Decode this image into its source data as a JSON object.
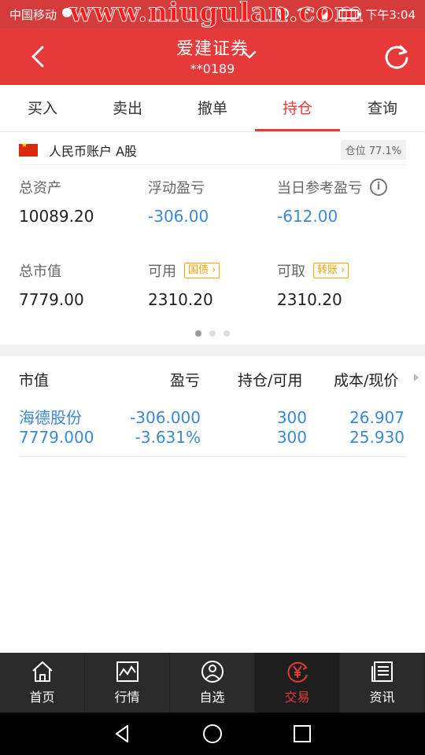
{
  "status_bar": {
    "carrier": "中国移动",
    "watermark": "www.niugulan.com",
    "time": "下午3:04"
  },
  "header": {
    "title": "爱建证券",
    "account_suffix": "**0189"
  },
  "tabs": [
    {
      "label": "买入"
    },
    {
      "label": "卖出"
    },
    {
      "label": "撤单"
    },
    {
      "label": "持仓",
      "active": true
    },
    {
      "label": "查询"
    }
  ],
  "account": {
    "label": "人民币账户 A股",
    "position_ratio": "仓位 77.1%"
  },
  "summary": {
    "total_assets_label": "总资产",
    "total_assets_value": "10089.20",
    "floating_pl_label": "浮动盈亏",
    "floating_pl_value": "-306.00",
    "daily_ref_pl_label": "当日参考盈亏",
    "daily_ref_pl_value": "-612.00",
    "market_value_label": "总市值",
    "market_value_value": "7779.00",
    "available_label": "可用",
    "available_tag": "国债",
    "available_value": "2310.20",
    "withdrawable_label": "可取",
    "withdrawable_tag": "转账",
    "withdrawable_value": "2310.20"
  },
  "pager": {
    "count": 3,
    "active": 0
  },
  "table": {
    "headers": [
      "市值",
      "盈亏",
      "持仓/可用",
      "成本/现价"
    ],
    "rows": [
      {
        "name": "海德股份",
        "market_value": "7779.000",
        "pl": "-306.000",
        "pl_pct": "-3.631%",
        "holding": "300",
        "available": "300",
        "cost": "26.907",
        "price": "25.930"
      }
    ]
  },
  "bottom_nav": [
    {
      "label": "首页",
      "icon": "home-icon"
    },
    {
      "label": "行情",
      "icon": "market-chart-icon"
    },
    {
      "label": "自选",
      "icon": "user-icon"
    },
    {
      "label": "交易",
      "icon": "yuan-trade-icon",
      "active": true
    },
    {
      "label": "资讯",
      "icon": "news-icon"
    }
  ],
  "colors": {
    "brand_red": "#e5393a",
    "value_blue": "#3b89d6",
    "tag_orange": "#f0a500"
  }
}
